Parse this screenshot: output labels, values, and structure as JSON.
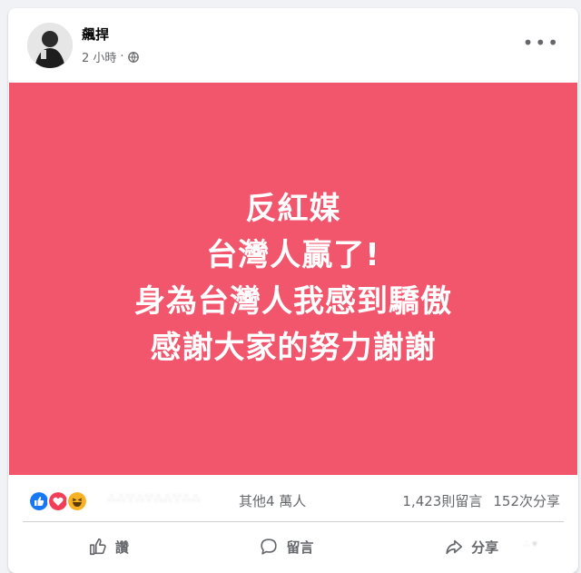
{
  "post": {
    "author": "飆捍",
    "time": "2 小時",
    "separator": "·",
    "privacy_icon": "globe-icon",
    "more_icon": "more-options-icon"
  },
  "image_text": {
    "lines": [
      "反紅媒",
      "台灣人贏了!",
      "身為台灣人我感到驕傲",
      "感謝大家的努力謝謝"
    ],
    "background": "#f1566d",
    "text_color": "#ffffff"
  },
  "stats": {
    "reactions": [
      "like-icon",
      "love-icon",
      "haha-icon"
    ],
    "others": "其他4 萬人",
    "comments": "1,423則留言",
    "shares": "152次分享"
  },
  "actions": {
    "like": "讚",
    "comment": "留言",
    "share": "分享"
  },
  "colors": {
    "like_blue": "#1877f2",
    "love_red": "#f33e58",
    "haha_yellow": "#f7b125",
    "secondary_text": "#65676b"
  }
}
